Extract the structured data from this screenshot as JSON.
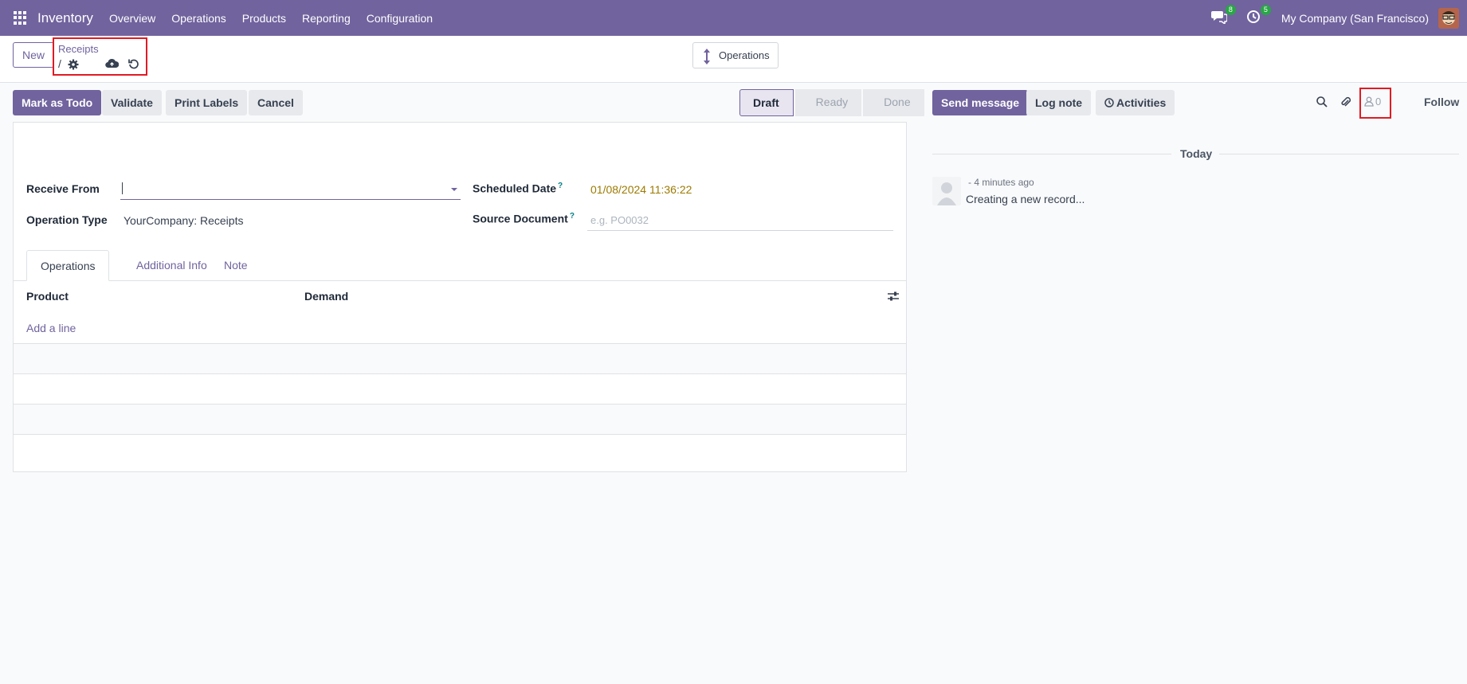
{
  "navbar": {
    "app_name": "Inventory",
    "menu": [
      "Overview",
      "Operations",
      "Products",
      "Reporting",
      "Configuration"
    ],
    "messages_count": "8",
    "activities_count": "5",
    "company": "My Company (San Francisco)"
  },
  "control": {
    "new_label": "New",
    "breadcrumb_parent": "Receipts",
    "breadcrumb_separator": "/",
    "operations_label": "Operations"
  },
  "actions": {
    "mark_todo": "Mark as Todo",
    "validate": "Validate",
    "print_labels": "Print Labels",
    "cancel": "Cancel"
  },
  "statusbar": {
    "stages": [
      "Draft",
      "Ready",
      "Done"
    ],
    "active": "Draft"
  },
  "form": {
    "receive_from_label": "Receive From",
    "receive_from_value": "",
    "operation_type_label": "Operation Type",
    "operation_type_value": "YourCompany: Receipts",
    "scheduled_date_label": "Scheduled Date",
    "scheduled_date_help": "?",
    "scheduled_date_value": "01/08/2024 11:36:22",
    "source_document_label": "Source Document",
    "source_document_help": "?",
    "source_document_placeholder": "e.g. PO0032",
    "tabs": [
      "Operations",
      "Additional Info",
      "Note"
    ],
    "active_tab": "Operations",
    "columns": [
      "Product",
      "Demand"
    ],
    "add_line": "Add a line"
  },
  "chatter": {
    "send_message": "Send message",
    "log_note": "Log note",
    "activities": "Activities",
    "followers_count": "0",
    "follow": "Follow",
    "today": "Today",
    "message_time": "- 4 minutes ago",
    "message_body": "Creating a new record..."
  },
  "colors": {
    "brand": "#71639e",
    "highlight": "#e01b24",
    "badge": "#28a745"
  }
}
